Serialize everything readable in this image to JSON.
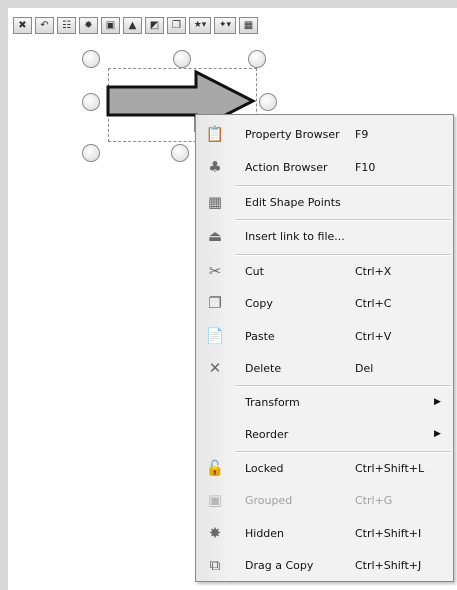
{
  "toolbar": {
    "buttons": [
      {
        "icon": "close-icon",
        "glyph": "✖"
      },
      {
        "icon": "undo-icon",
        "glyph": "↶"
      },
      {
        "icon": "properties-icon",
        "glyph": "☷"
      },
      {
        "icon": "gear-icon",
        "glyph": "✹"
      },
      {
        "icon": "layers-icon",
        "glyph": "▣"
      },
      {
        "icon": "triangle-icon",
        "glyph": "▲"
      },
      {
        "icon": "shapes-icon",
        "glyph": "◩"
      },
      {
        "icon": "copy-icon",
        "glyph": "❐"
      },
      {
        "icon": "star-dropdown-icon",
        "glyph": "★▾"
      },
      {
        "icon": "star-small-dropdown-icon",
        "glyph": "✦▾"
      },
      {
        "icon": "frame-icon",
        "glyph": "▦"
      }
    ]
  },
  "shape": {
    "fill": "#a8a8a8",
    "stroke": "#111111"
  },
  "menu": {
    "items": [
      {
        "label": "Property Browser",
        "shortcut": "F9",
        "icon": "property-browser-icon",
        "glyph": "📋",
        "enabled": true,
        "submenu": false
      },
      {
        "label": "Action Browser",
        "shortcut": "F10",
        "icon": "action-browser-icon",
        "glyph": "♣",
        "enabled": true,
        "submenu": false
      },
      {
        "label": "Edit Shape Points",
        "shortcut": "",
        "icon": "edit-points-icon",
        "glyph": "▦",
        "enabled": true,
        "submenu": false
      },
      {
        "label": "Insert link to file...",
        "shortcut": "",
        "icon": "insert-link-icon",
        "glyph": "⏏",
        "enabled": true,
        "submenu": false
      },
      {
        "label": "Cut",
        "shortcut": "Ctrl+X",
        "icon": "scissors-icon",
        "glyph": "✂",
        "enabled": true,
        "submenu": false
      },
      {
        "label": "Copy",
        "shortcut": "Ctrl+C",
        "icon": "copy-icon",
        "glyph": "❐",
        "enabled": true,
        "submenu": false
      },
      {
        "label": "Paste",
        "shortcut": "Ctrl+V",
        "icon": "paste-icon",
        "glyph": "📄",
        "enabled": true,
        "submenu": false
      },
      {
        "label": "Delete",
        "shortcut": "Del",
        "icon": "delete-icon",
        "glyph": "✕",
        "enabled": true,
        "submenu": false
      },
      {
        "label": "Transform",
        "shortcut": "",
        "icon": "",
        "glyph": "",
        "enabled": true,
        "submenu": true
      },
      {
        "label": "Reorder",
        "shortcut": "",
        "icon": "",
        "glyph": "",
        "enabled": true,
        "submenu": true
      },
      {
        "label": "Locked",
        "shortcut": "Ctrl+Shift+L",
        "icon": "lock-icon",
        "glyph": "🔓",
        "enabled": true,
        "submenu": false
      },
      {
        "label": "Grouped",
        "shortcut": "Ctrl+G",
        "icon": "group-icon",
        "glyph": "▣",
        "enabled": false,
        "submenu": false
      },
      {
        "label": "Hidden",
        "shortcut": "Ctrl+Shift+I",
        "icon": "hidden-icon",
        "glyph": "✸",
        "enabled": true,
        "submenu": false
      },
      {
        "label": "Drag a Copy",
        "shortcut": "Ctrl+Shift+J",
        "icon": "drag-copy-icon",
        "glyph": "⧉",
        "enabled": true,
        "submenu": false
      }
    ],
    "submenu_glyph": "▶"
  }
}
